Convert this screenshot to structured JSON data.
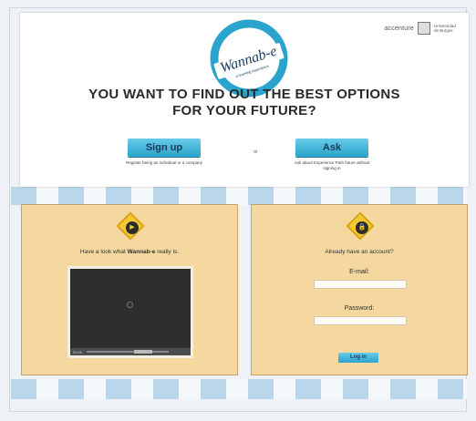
{
  "brand": {
    "logo_text": "Wannab-e",
    "logo_tagline": "a learning experience",
    "partner_1": "accenture",
    "partner_2": "Universidad de Burgos"
  },
  "hero": {
    "headline_line1": "YOU WANT TO FIND OUT THE BEST OPTIONS",
    "headline_line2": "FOR YOUR FUTURE?"
  },
  "actions": {
    "signup_label": "Sign up",
    "signup_desc": "Register being an individual or a company",
    "or_label": "or",
    "ask_label": "Ask",
    "ask_desc": "Ask about Experience Path future without signing in"
  },
  "video_panel": {
    "caption_prefix": "Have a look what ",
    "caption_brand": "Wannab-e",
    "caption_suffix": " really is.",
    "play_icon": "play-icon",
    "time": "00:00"
  },
  "login_panel": {
    "lock_icon": "lock-icon",
    "heading": "Already have an account?",
    "email_label": "E-mail:",
    "password_label": "Password:",
    "login_button": "Log in"
  },
  "colors": {
    "accent": "#2aa4cc",
    "panel": "#f5d8a0",
    "badge": "#f5c933"
  }
}
